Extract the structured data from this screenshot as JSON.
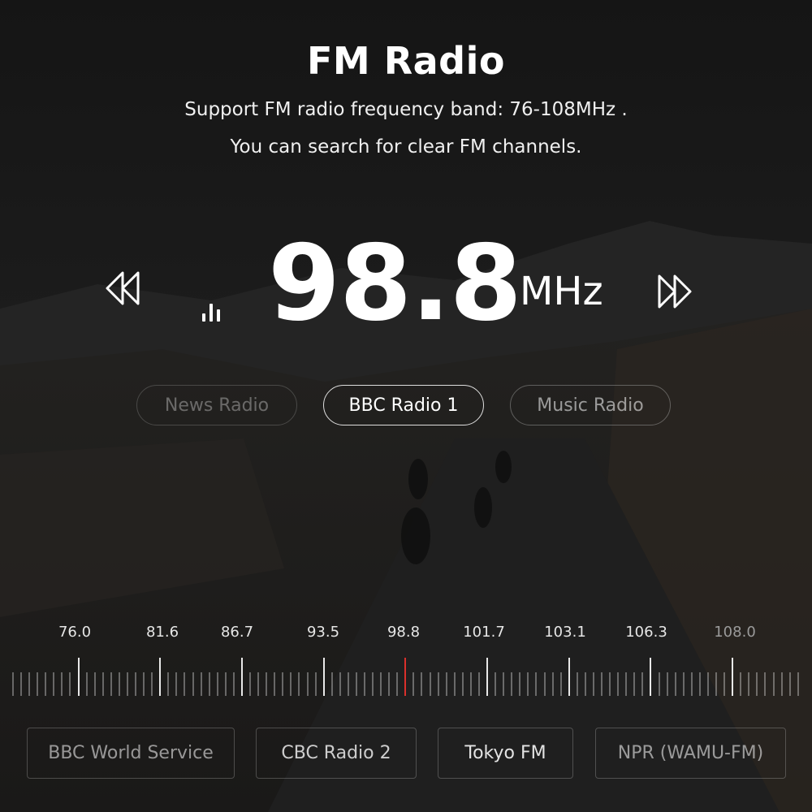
{
  "header": {
    "title": "FM Radio",
    "subtitle_line1": "Support FM radio frequency band: 76-108MHz .",
    "subtitle_line2": "You can search for clear FM channels."
  },
  "tuner": {
    "frequency": "98.8",
    "unit": "MHz",
    "prev_icon": "rewind-icon",
    "next_icon": "fast-forward-icon",
    "signal_icon": "signal-bars-icon"
  },
  "presets": [
    {
      "label": "News Radio",
      "state": "dim"
    },
    {
      "label": "BBC Radio 1",
      "state": "active"
    },
    {
      "label": "Music Radio",
      "state": "mid"
    }
  ],
  "scale": {
    "labels": [
      "76.0",
      "81.6",
      "86.7",
      "93.5",
      "98.8",
      "101.7",
      "103.1",
      "106.3",
      "108.0"
    ],
    "current": "98.8",
    "current_color": "#d9302c"
  },
  "stations": [
    {
      "label": "BBC World Service"
    },
    {
      "label": "CBC Radio 2"
    },
    {
      "label": "Tokyo FM"
    },
    {
      "label": "NPR (WAMU-FM)"
    }
  ]
}
